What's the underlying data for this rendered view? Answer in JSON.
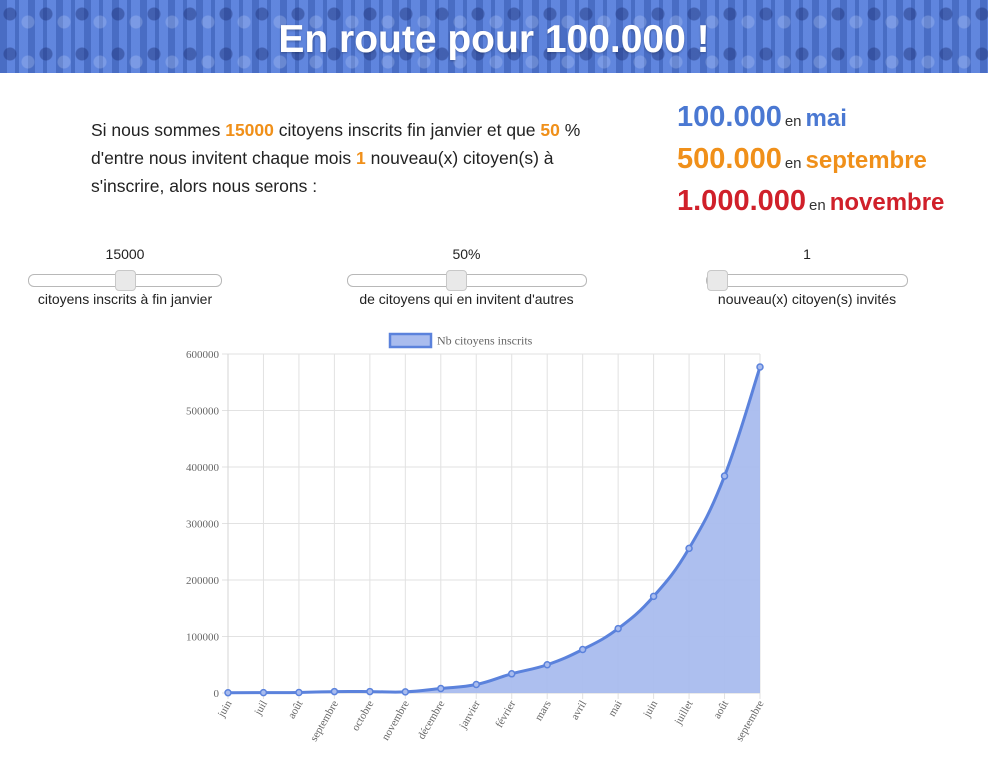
{
  "header": {
    "title": "En route pour 100.000 !"
  },
  "intro": {
    "t1": "Si nous sommes ",
    "citizens": "15000",
    "t2": " citoyens inscrits fin janvier et que ",
    "percent": "50",
    "t3": " % d'entre nous invitent chaque mois ",
    "invites": "1",
    "t4": " nouveau(x) citoyen(s) à s'inscrire, alors nous serons :"
  },
  "results": [
    {
      "number": "100.000",
      "en": "en",
      "month": "mai",
      "color": "#4a78d2"
    },
    {
      "number": "500.000",
      "en": "en",
      "month": "septembre",
      "color": "#f0901a"
    },
    {
      "number": "1.000.000",
      "en": "en",
      "month": "novembre",
      "color": "#d0202a"
    }
  ],
  "sliders": [
    {
      "value_label": "15000",
      "label": "citoyens inscrits à fin janvier",
      "fraction": 0.5
    },
    {
      "value_label": "50%",
      "label": "de citoyens qui en invitent d'autres",
      "fraction": 0.45
    },
    {
      "value_label": "1",
      "label": "nouveau(x) citoyen(s) invités",
      "fraction": 0.0
    }
  ],
  "chart_data": {
    "type": "area",
    "legend": "Nb citoyens inscrits",
    "legend_position": "top",
    "grid": true,
    "categories": [
      "juin",
      "juil",
      "août",
      "septembre",
      "octobre",
      "novembre",
      "décembre",
      "janvier",
      "février",
      "mars",
      "avril",
      "mai",
      "juin",
      "juillet",
      "août",
      "septembre"
    ],
    "values": [
      500,
      700,
      900,
      2500,
      2500,
      2000,
      8000,
      15000,
      34000,
      50000,
      77000,
      114000,
      171000,
      256000,
      384000,
      577000
    ],
    "yticks": [
      0,
      100000,
      200000,
      300000,
      400000,
      500000,
      600000
    ],
    "ytick_labels": [
      "0",
      "100000",
      "200000",
      "300000",
      "400000",
      "500000",
      "600000"
    ],
    "ylim": [
      0,
      600000
    ],
    "line_color": "#5b82dc",
    "fill_color": "#a9bcee"
  }
}
